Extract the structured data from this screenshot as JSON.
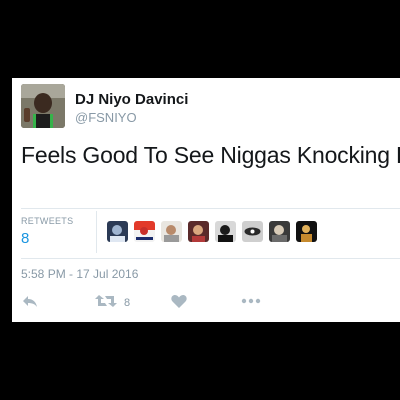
{
  "tweet": {
    "author": {
      "display_name": "DJ Niyo Davinci",
      "handle": "@FSNIYO"
    },
    "text": "Feels Good To See Niggas Knocking Pigs Off.",
    "stats": {
      "retweets_label": "RETWEETS",
      "retweets_count": "8"
    },
    "retweeter_count_shown": 8,
    "timestamp": "5:58 PM - 17 Jul 2016",
    "actions": {
      "reply_icon": "reply-icon",
      "retweet_icon": "retweet-icon",
      "retweet_count": "8",
      "like_icon": "heart-icon",
      "more_icon": "more-dots-icon"
    }
  },
  "colors": {
    "background": "#000000",
    "card": "#ffffff",
    "text": "#14171a",
    "muted": "#8899a6",
    "link": "#1b95e0",
    "action_icon": "#aab8c2"
  }
}
